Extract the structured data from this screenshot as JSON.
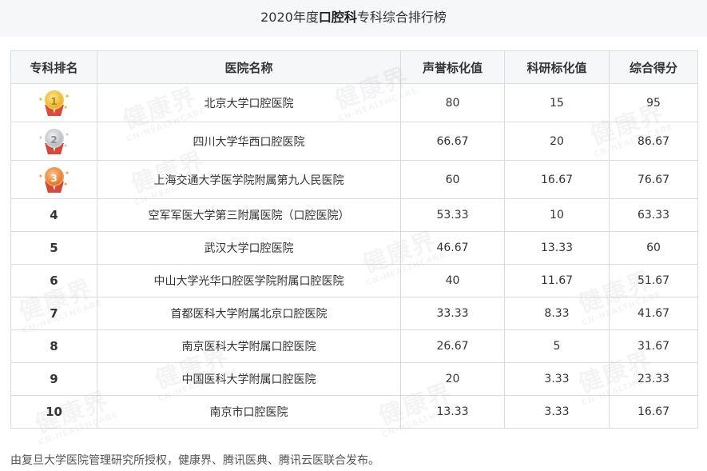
{
  "title": {
    "prefix": "2020年度",
    "highlight": "口腔科",
    "suffix": "专科综合排行榜"
  },
  "table": {
    "headers": {
      "rank": "专科排名",
      "hospital": "医院名称",
      "reputation": "声誉标化值",
      "research": "科研标化值",
      "total": "综合得分"
    },
    "rows": [
      {
        "rank": "1",
        "medal": "gold-medal-icon",
        "hospital": "北京大学口腔医院",
        "reputation": "80",
        "research": "15",
        "total": "95"
      },
      {
        "rank": "2",
        "medal": "silver-medal-icon",
        "hospital": "四川大学华西口腔医院",
        "reputation": "66.67",
        "research": "20",
        "total": "86.67"
      },
      {
        "rank": "3",
        "medal": "bronze-medal-icon",
        "hospital": "上海交通大学医学院附属第九人民医院",
        "reputation": "60",
        "research": "16.67",
        "total": "76.67"
      },
      {
        "rank": "4",
        "hospital": "空军军医大学第三附属医院（口腔医院）",
        "reputation": "53.33",
        "research": "10",
        "total": "63.33"
      },
      {
        "rank": "5",
        "hospital": "武汉大学口腔医院",
        "reputation": "46.67",
        "research": "13.33",
        "total": "60"
      },
      {
        "rank": "6",
        "hospital": "中山大学光华口腔医学院附属口腔医院",
        "reputation": "40",
        "research": "11.67",
        "total": "51.67"
      },
      {
        "rank": "7",
        "hospital": "首都医科大学附属北京口腔医院",
        "reputation": "33.33",
        "research": "8.33",
        "total": "41.67"
      },
      {
        "rank": "8",
        "hospital": "南京医科大学附属口腔医院",
        "reputation": "26.67",
        "research": "5",
        "total": "31.67"
      },
      {
        "rank": "9",
        "hospital": "中国医科大学附属口腔医院",
        "reputation": "20",
        "research": "3.33",
        "total": "23.33"
      },
      {
        "rank": "10",
        "hospital": "南京市口腔医院",
        "reputation": "13.33",
        "research": "3.33",
        "total": "16.67"
      }
    ]
  },
  "watermark": {
    "main": "健康界",
    "sub": "CN-HEALTHCARE"
  },
  "footer": "由复旦大学医院管理研究所授权，健康界、腾讯医典、腾讯云医联合发布。",
  "colors": {
    "link": "#2a6fc9",
    "header_bg": "#f6f7f9",
    "border": "#d9dde3"
  }
}
